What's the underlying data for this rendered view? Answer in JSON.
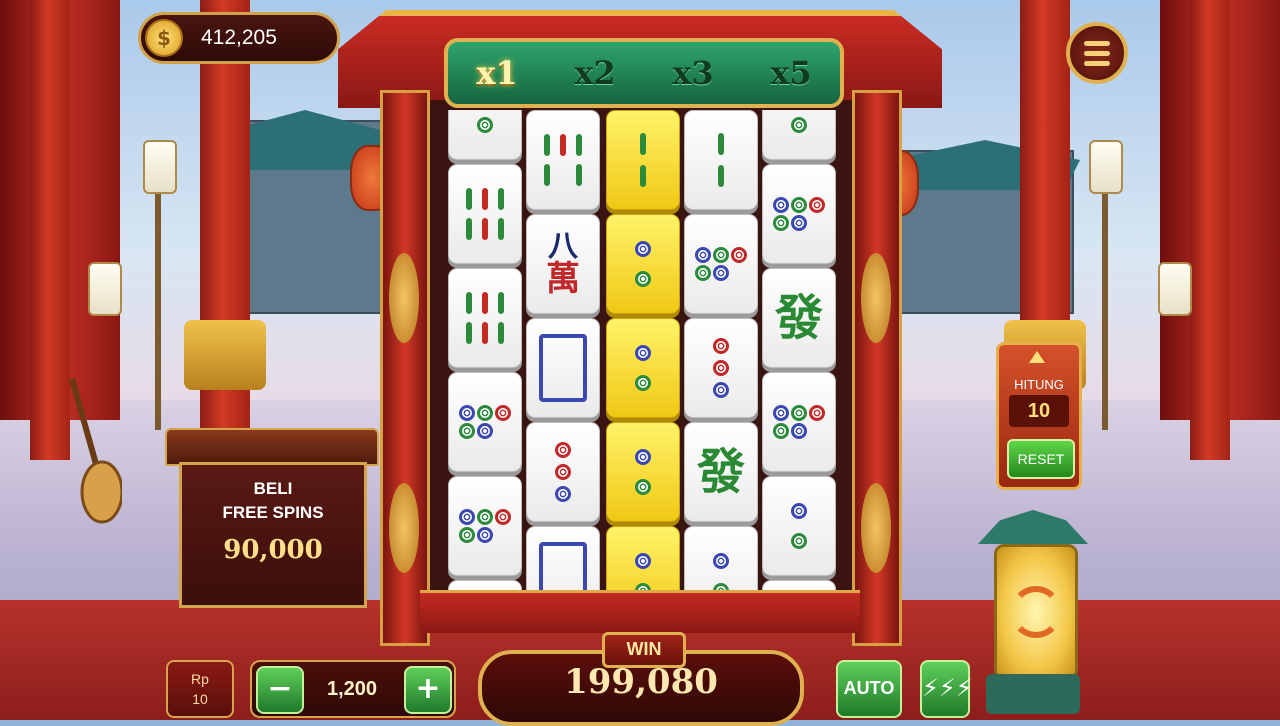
{
  "balance": {
    "icon": "coin-icon",
    "coin_symbol": "$",
    "value": "412,205"
  },
  "multipliers": [
    {
      "label": "x1",
      "active": true
    },
    {
      "label": "x2",
      "active": false
    },
    {
      "label": "x3",
      "active": false
    },
    {
      "label": "x5",
      "active": false
    }
  ],
  "buy_free_spins": {
    "line1": "BELI",
    "line2": "FREE SPINS",
    "price": "90,000"
  },
  "hitung": {
    "label": "HITUNG",
    "value": "10",
    "reset_label": "RESET"
  },
  "bottom": {
    "currency_line1": "Rp",
    "currency_line2": "10",
    "minus_label": "−",
    "bet_value": "1,200",
    "plus_label": "+",
    "win_label": "WIN",
    "win_value": "199,080",
    "auto_label": "AUTO",
    "turbo_symbol": "⚡⚡⚡"
  },
  "reels": [
    [
      "partial",
      "bamboo-6",
      "bamboo-6",
      "circle-5",
      "circle-5",
      "partial"
    ],
    [
      "bamboo-5",
      "character-8",
      "white-dragon",
      "circle-3",
      "white-dragon"
    ],
    [
      "gold-bamboo-2",
      "gold-circle-2",
      "gold-circle-2",
      "gold-circle-2",
      "gold-circle-2"
    ],
    [
      "bamboo-2",
      "circle-5",
      "circle-3",
      "green-dragon",
      "circle-2"
    ],
    [
      "partial",
      "circle-5",
      "green-dragon",
      "circle-5",
      "circle-2",
      "partial"
    ]
  ],
  "tile_text": {
    "character_top": "八",
    "character_bottom": "萬",
    "green_dragon": "發"
  },
  "colors": {
    "gold": "#e0b24f",
    "green_button": "#2f9a3c",
    "red_frame": "#c92b22"
  }
}
